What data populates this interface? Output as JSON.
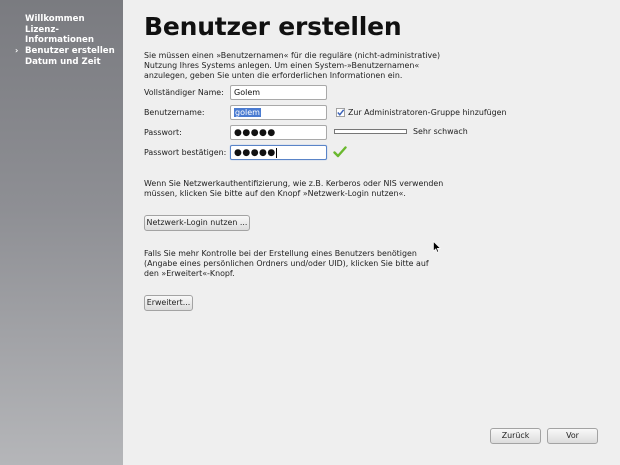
{
  "sidebar": {
    "items": [
      {
        "label": "Willkommen",
        "current": false
      },
      {
        "label": "Lizenz-Informationen",
        "current": false
      },
      {
        "label": "Benutzer erstellen",
        "current": true
      },
      {
        "label": "Datum und Zeit",
        "current": false
      }
    ],
    "current_marker": "›"
  },
  "main": {
    "title": "Benutzer erstellen",
    "intro": "Sie müssen einen »Benutzernamen« für die reguläre (nicht-administrative) Nutzung Ihres Systems anlegen. Um einen System-»Benutzernamen« anzulegen, geben Sie unten die erforderlichen Informationen ein.",
    "form": {
      "fullname_label": "Vollständiger Name:",
      "fullname_value": "Golem",
      "username_label": "Benutzername:",
      "username_value": "golem",
      "admin_group_label": "Zur Administratoren-Gruppe hinzufügen",
      "admin_group_checked": true,
      "password_label": "Passwort:",
      "password_value": "●●●●●",
      "strength_text": "Sehr schwach",
      "strength_level": 0.0,
      "confirm_label": "Passwort bestätigen:",
      "confirm_value": "●●●●●"
    },
    "network_text": "Wenn Sie Netzwerkauthentifizierung, wie z.B. Kerberos oder NIS verwenden müssen, klicken Sie bitte auf den Knopf »Netzwerk-Login nutzen«.",
    "network_button": "Netzwerk-Login nutzen ...",
    "advanced_text": "Falls Sie mehr Kontrolle bei der Erstellung eines Benutzers benötigen (Angabe eines persönlichen Ordners und/oder UID), klicken Sie bitte auf den »Erweitert«-Knopf.",
    "advanced_button": "Erweitert...",
    "back_button": "Zurück",
    "forward_button": "Vor"
  },
  "colors": {
    "sidebar_top": "#7a7b80",
    "sidebar_bottom": "#b5b6b9",
    "selection": "#4a7bd1",
    "ok_green": "#6ab82e"
  }
}
